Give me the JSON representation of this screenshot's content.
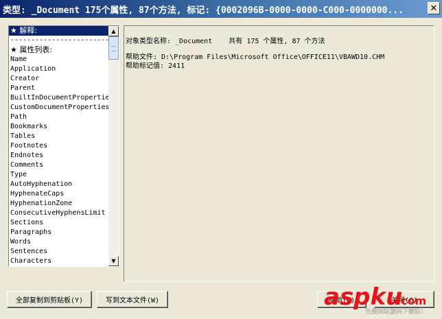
{
  "window": {
    "title": "类型: _Document  175个属性, 87个方法, 标记: {0002096B-0000-0000-C000-0000000...",
    "close_glyph": "✕"
  },
  "list": {
    "items": [
      {
        "label": "★ 解释:",
        "kind": "header",
        "selected": true
      },
      {
        "label": "------------------------",
        "kind": "divider"
      },
      {
        "label": "★ 属性列表:",
        "kind": "header"
      },
      {
        "label": "Name"
      },
      {
        "label": "Application"
      },
      {
        "label": "Creator"
      },
      {
        "label": "Parent"
      },
      {
        "label": "BuiltInDocumentPropertie"
      },
      {
        "label": "CustomDocumentProperties"
      },
      {
        "label": "Path"
      },
      {
        "label": "Bookmarks"
      },
      {
        "label": "Tables"
      },
      {
        "label": "Footnotes"
      },
      {
        "label": "Endnotes"
      },
      {
        "label": "Comments"
      },
      {
        "label": "Type"
      },
      {
        "label": "AutoHyphenation"
      },
      {
        "label": "HyphenateCaps"
      },
      {
        "label": "HyphenationZone"
      },
      {
        "label": "ConsecutiveHyphensLimit"
      },
      {
        "label": "Sections"
      },
      {
        "label": "Paragraphs"
      },
      {
        "label": "Words"
      },
      {
        "label": "Sentences"
      },
      {
        "label": "Characters"
      }
    ]
  },
  "info": {
    "line1": "对象类型名称: _Document    共有 175 个属性, 87 个方法",
    "line2": "帮助文件: D:\\Program Files\\Microsoft Office\\OFFICE11\\VBAWD10.CHM",
    "line3": "帮助标记值: 2411"
  },
  "buttons": {
    "copy_label": "全部复制到剪贴板(Y)",
    "write_label": "写到文本文件(W)",
    "help_label": "帮助(H)",
    "close_label": "关闭(C)"
  },
  "watermark": {
    "brand": "aspku",
    "suffix": ".com",
    "tagline": "免费网站源码下载站!",
    "brand_color": "#E8141C"
  }
}
